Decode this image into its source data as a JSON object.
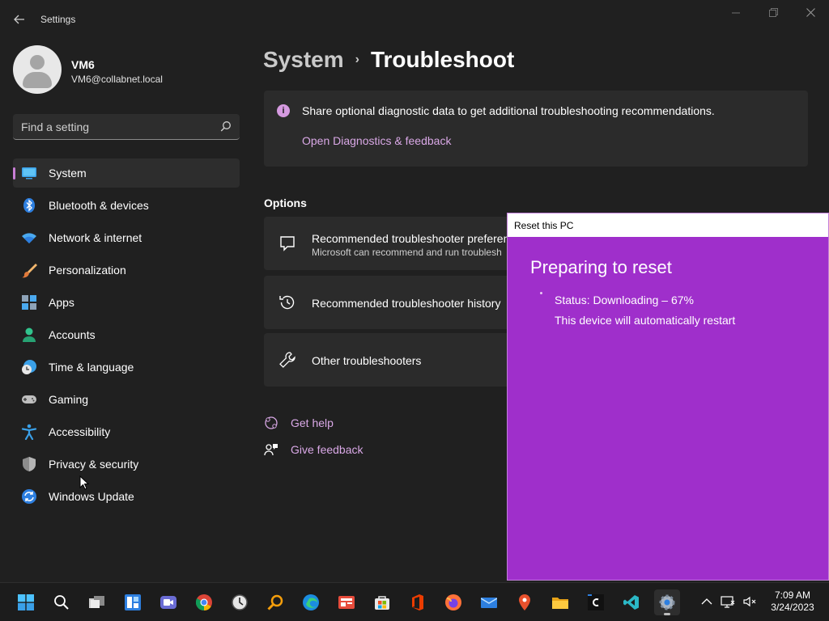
{
  "window": {
    "app_title": "Settings",
    "back_icon": "back-arrow-icon",
    "controls": {
      "minimize_icon": "minimize-icon",
      "restore_icon": "restore-icon",
      "close_icon": "close-icon"
    }
  },
  "profile": {
    "name": "VM6",
    "email": "VM6@collabnet.local"
  },
  "search": {
    "placeholder": "Find a setting",
    "icon": "search-icon"
  },
  "sidebar": {
    "items": [
      {
        "label": "System",
        "icon": "system-icon",
        "active": true
      },
      {
        "label": "Bluetooth & devices",
        "icon": "bluetooth-icon"
      },
      {
        "label": "Network & internet",
        "icon": "wifi-icon"
      },
      {
        "label": "Personalization",
        "icon": "brush-icon"
      },
      {
        "label": "Apps",
        "icon": "apps-icon"
      },
      {
        "label": "Accounts",
        "icon": "accounts-icon"
      },
      {
        "label": "Time & language",
        "icon": "clock-globe-icon"
      },
      {
        "label": "Gaming",
        "icon": "gamepad-icon"
      },
      {
        "label": "Accessibility",
        "icon": "accessibility-icon"
      },
      {
        "label": "Privacy & security",
        "icon": "shield-icon"
      },
      {
        "label": "Windows Update",
        "icon": "update-icon"
      }
    ]
  },
  "main": {
    "breadcrumb": {
      "parent": "System",
      "separator": "›",
      "current": "Troubleshoot"
    },
    "info_card": {
      "icon": "info-icon",
      "text": "Share optional diagnostic data to get additional troubleshooting recommendations.",
      "link": "Open Diagnostics & feedback"
    },
    "options_title": "Options",
    "options": [
      {
        "title": "Recommended troubleshooter preferen",
        "subtitle": "Microsoft can recommend and run troublesh",
        "icon": "chat-bubble-icon"
      },
      {
        "title": "Recommended troubleshooter history",
        "icon": "history-icon"
      },
      {
        "title": "Other troubleshooters",
        "icon": "wrench-icon"
      }
    ],
    "help_links": [
      {
        "label": "Get help",
        "icon": "help-icon"
      },
      {
        "label": "Give feedback",
        "icon": "feedback-icon"
      }
    ]
  },
  "dialog": {
    "title": "Reset this PC",
    "heading": "Preparing to reset",
    "status": "Status: Downloading – 67%",
    "progress_percent": 67,
    "restart_note": "This device will automatically restart",
    "background_color": "#9f2fcb"
  },
  "taskbar": {
    "apps": [
      {
        "name": "start-icon"
      },
      {
        "name": "search-icon"
      },
      {
        "name": "task-view-icon"
      },
      {
        "name": "widgets-icon"
      },
      {
        "name": "teams-chat-icon"
      },
      {
        "name": "chrome-icon"
      },
      {
        "name": "clock-app-icon"
      },
      {
        "name": "magnifier-icon"
      },
      {
        "name": "edge-icon"
      },
      {
        "name": "news-icon"
      },
      {
        "name": "store-icon"
      },
      {
        "name": "office-icon"
      },
      {
        "name": "firefox-icon"
      },
      {
        "name": "mail-icon"
      },
      {
        "name": "maps-icon"
      },
      {
        "name": "file-explorer-icon"
      },
      {
        "name": "code-app-icon"
      },
      {
        "name": "vscode-icon"
      },
      {
        "name": "settings-icon",
        "active": true
      }
    ],
    "tray": {
      "chevron_icon": "chevron-up-icon",
      "network_icon": "network-icon",
      "sound_icon": "sound-muted-icon"
    },
    "clock": {
      "time": "7:09 AM",
      "date": "3/24/2023"
    }
  },
  "colors": {
    "accent": "#c87ed5",
    "link": "#d9a8e6",
    "background": "#202020",
    "card": "#2b2b2b"
  }
}
